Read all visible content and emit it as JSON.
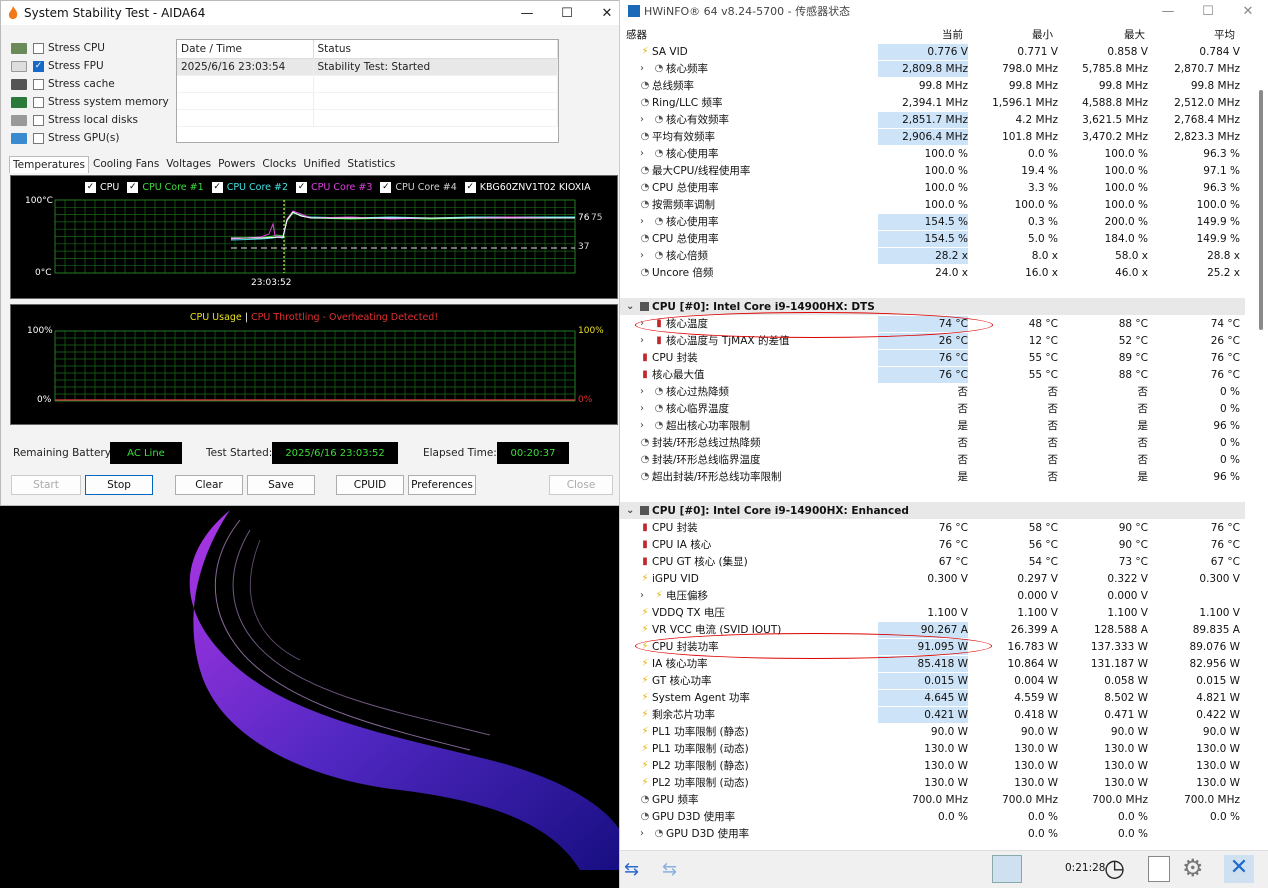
{
  "aida": {
    "title": "System Stability Test - AIDA64",
    "stress": [
      {
        "label": "Stress CPU",
        "checked": false
      },
      {
        "label": "Stress FPU",
        "checked": true
      },
      {
        "label": "Stress cache",
        "checked": false
      },
      {
        "label": "Stress system memory",
        "checked": false
      },
      {
        "label": "Stress local disks",
        "checked": false
      },
      {
        "label": "Stress GPU(s)",
        "checked": false
      }
    ],
    "log_headers": [
      "Date / Time",
      "Status"
    ],
    "log_rows": [
      [
        "2025/6/16 23:03:54",
        "Stability Test: Started"
      ]
    ],
    "tabs": [
      "Temperatures",
      "Cooling Fans",
      "Voltages",
      "Powers",
      "Clocks",
      "Unified",
      "Statistics"
    ],
    "temp_legend": [
      {
        "label": "CPU",
        "color": "#ffffff"
      },
      {
        "label": "CPU Core #1",
        "color": "#3cdc3c"
      },
      {
        "label": "CPU Core #2",
        "color": "#40e0e0"
      },
      {
        "label": "CPU Core #3",
        "color": "#e040e0"
      },
      {
        "label": "CPU Core #4",
        "color": "#d0d0d0"
      },
      {
        "label": "KBG60ZNV1T02 KIOXIA",
        "color": "#ffffff"
      }
    ],
    "temp_ymax": "100°C",
    "temp_ymin": "0°C",
    "temp_time": "23:03:52",
    "temp_right1": "76",
    "temp_right2": "75",
    "temp_right3": "37",
    "usage_title1": "CPU Usage",
    "usage_sep": "|",
    "usage_title2": "CPU Throttling - Overheating Detected!",
    "usage_left_top": "100%",
    "usage_left_bot": "0%",
    "usage_right_top": "100%",
    "usage_right_bot": "0%",
    "battery_label": "Remaining Battery:",
    "battery_value": "AC Line",
    "started_label": "Test Started:",
    "started_value": "2025/6/16 23:03:52",
    "elapsed_label": "Elapsed Time:",
    "elapsed_value": "00:20:37",
    "buttons": {
      "start": "Start",
      "stop": "Stop",
      "clear": "Clear",
      "save": "Save",
      "cpuid": "CPUID",
      "preferences": "Preferences",
      "close": "Close"
    }
  },
  "hw": {
    "title": "HWiNFO® 64 v8.24-5700 - 传感器状态",
    "headers": [
      "感器",
      "当前",
      "最小",
      "最大",
      "平均"
    ],
    "rows": [
      {
        "icon": "bolt",
        "label": "SA VID",
        "c": "0.776 V",
        "mn": "0.771 V",
        "mx": "0.858 V",
        "av": "0.784 V",
        "hl": true
      },
      {
        "icon": "clock",
        "exp": true,
        "label": "核心频率",
        "c": "2,809.8 MHz",
        "mn": "798.0 MHz",
        "mx": "5,785.8 MHz",
        "av": "2,870.7 MHz",
        "hl": true
      },
      {
        "icon": "clock",
        "label": "总线频率",
        "c": "99.8 MHz",
        "mn": "99.8 MHz",
        "mx": "99.8 MHz",
        "av": "99.8 MHz"
      },
      {
        "icon": "clock",
        "label": "Ring/LLC 频率",
        "c": "2,394.1 MHz",
        "mn": "1,596.1 MHz",
        "mx": "4,588.8 MHz",
        "av": "2,512.0 MHz"
      },
      {
        "icon": "clock",
        "exp": true,
        "label": "核心有效频率",
        "c": "2,851.7 MHz",
        "mn": "4.2 MHz",
        "mx": "3,621.5 MHz",
        "av": "2,768.4 MHz",
        "hl": true
      },
      {
        "icon": "clock",
        "label": "平均有效频率",
        "c": "2,906.4 MHz",
        "mn": "101.8 MHz",
        "mx": "3,470.2 MHz",
        "av": "2,823.3 MHz",
        "hl": true
      },
      {
        "icon": "clock",
        "exp": true,
        "label": "核心使用率",
        "c": "100.0 %",
        "mn": "0.0 %",
        "mx": "100.0 %",
        "av": "96.3 %"
      },
      {
        "icon": "clock",
        "label": "最大CPU/线程使用率",
        "c": "100.0 %",
        "mn": "19.4 %",
        "mx": "100.0 %",
        "av": "97.1 %"
      },
      {
        "icon": "clock",
        "label": "CPU 总使用率",
        "c": "100.0 %",
        "mn": "3.3 %",
        "mx": "100.0 %",
        "av": "96.3 %"
      },
      {
        "icon": "clock",
        "label": "按需频率调制",
        "c": "100.0 %",
        "mn": "100.0 %",
        "mx": "100.0 %",
        "av": "100.0 %"
      },
      {
        "icon": "clock",
        "exp": true,
        "label": "核心使用率",
        "c": "154.5 %",
        "mn": "0.3 %",
        "mx": "200.0 %",
        "av": "149.9 %",
        "hl": true
      },
      {
        "icon": "clock",
        "label": "CPU 总使用率",
        "c": "154.5 %",
        "mn": "5.0 %",
        "mx": "184.0 %",
        "av": "149.9 %",
        "hl": true
      },
      {
        "icon": "clock",
        "exp": true,
        "label": "核心倍频",
        "c": "28.2 x",
        "mn": "8.0 x",
        "mx": "58.0 x",
        "av": "28.8 x",
        "hl": true
      },
      {
        "icon": "clock",
        "label": "Uncore 倍频",
        "c": "24.0 x",
        "mn": "16.0 x",
        "mx": "46.0 x",
        "av": "25.2 x"
      },
      {
        "blank": true
      },
      {
        "section": true,
        "label": "CPU [#0]: Intel Core i9-14900HX: DTS"
      },
      {
        "icon": "therm",
        "exp": true,
        "label": "核心温度",
        "c": "74 °C",
        "mn": "48 °C",
        "mx": "88 °C",
        "av": "74 °C",
        "hl": true
      },
      {
        "icon": "therm",
        "exp": true,
        "label": "核心温度与 TjMAX 的差值",
        "c": "26 °C",
        "mn": "12 °C",
        "mx": "52 °C",
        "av": "26 °C",
        "hl": true
      },
      {
        "icon": "therm",
        "label": "CPU 封装",
        "c": "76 °C",
        "mn": "55 °C",
        "mx": "89 °C",
        "av": "76 °C",
        "hl": true
      },
      {
        "icon": "therm",
        "label": "核心最大值",
        "c": "76 °C",
        "mn": "55 °C",
        "mx": "88 °C",
        "av": "76 °C",
        "hl": true
      },
      {
        "icon": "clock",
        "exp": true,
        "label": "核心过热降频",
        "c": "否",
        "mn": "否",
        "mx": "否",
        "av": "0 %"
      },
      {
        "icon": "clock",
        "exp": true,
        "label": "核心临界温度",
        "c": "否",
        "mn": "否",
        "mx": "否",
        "av": "0 %"
      },
      {
        "icon": "clock",
        "exp": true,
        "label": "超出核心功率限制",
        "c": "是",
        "mn": "否",
        "mx": "是",
        "av": "96 %"
      },
      {
        "icon": "clock",
        "label": "封装/环形总线过热降频",
        "c": "否",
        "mn": "否",
        "mx": "否",
        "av": "0 %"
      },
      {
        "icon": "clock",
        "label": "封装/环形总线临界温度",
        "c": "否",
        "mn": "否",
        "mx": "否",
        "av": "0 %"
      },
      {
        "icon": "clock",
        "label": "超出封装/环形总线功率限制",
        "c": "是",
        "mn": "否",
        "mx": "是",
        "av": "96 %"
      },
      {
        "blank": true
      },
      {
        "section": true,
        "label": "CPU [#0]: Intel Core i9-14900HX: Enhanced"
      },
      {
        "icon": "therm",
        "label": "CPU 封装",
        "c": "76 °C",
        "mn": "58 °C",
        "mx": "90 °C",
        "av": "76 °C"
      },
      {
        "icon": "therm",
        "label": "CPU IA 核心",
        "c": "76 °C",
        "mn": "56 °C",
        "mx": "90 °C",
        "av": "76 °C"
      },
      {
        "icon": "therm",
        "label": "CPU GT 核心 (集显)",
        "c": "67 °C",
        "mn": "54 °C",
        "mx": "73 °C",
        "av": "67 °C"
      },
      {
        "icon": "bolt",
        "label": "iGPU VID",
        "c": "0.300 V",
        "mn": "0.297 V",
        "mx": "0.322 V",
        "av": "0.300 V"
      },
      {
        "icon": "bolt",
        "exp": true,
        "label": "电压偏移",
        "c": "",
        "mn": "0.000 V",
        "mx": "0.000 V",
        "av": ""
      },
      {
        "icon": "bolt",
        "label": "VDDQ TX 电压",
        "c": "1.100 V",
        "mn": "1.100 V",
        "mx": "1.100 V",
        "av": "1.100 V"
      },
      {
        "icon": "bolt",
        "label": "VR VCC 电流 (SVID IOUT)",
        "c": "90.267 A",
        "mn": "26.399 A",
        "mx": "128.588 A",
        "av": "89.835 A",
        "hl": true
      },
      {
        "icon": "bolt",
        "label": "CPU 封装功率",
        "c": "91.095 W",
        "mn": "16.783 W",
        "mx": "137.333 W",
        "av": "89.076 W",
        "hl": true
      },
      {
        "icon": "bolt",
        "label": "IA 核心功率",
        "c": "85.418 W",
        "mn": "10.864 W",
        "mx": "131.187 W",
        "av": "82.956 W",
        "hl": true
      },
      {
        "icon": "bolt",
        "label": "GT 核心功率",
        "c": "0.015 W",
        "mn": "0.004 W",
        "mx": "0.058 W",
        "av": "0.015 W",
        "hl": true
      },
      {
        "icon": "bolt",
        "label": "System Agent 功率",
        "c": "4.645 W",
        "mn": "4.559 W",
        "mx": "8.502 W",
        "av": "4.821 W",
        "hl": true
      },
      {
        "icon": "bolt",
        "label": "剩余芯片功率",
        "c": "0.421 W",
        "mn": "0.418 W",
        "mx": "0.471 W",
        "av": "0.422 W",
        "hl": true
      },
      {
        "icon": "bolt",
        "label": "PL1 功率限制 (静态)",
        "c": "90.0 W",
        "mn": "90.0 W",
        "mx": "90.0 W",
        "av": "90.0 W"
      },
      {
        "icon": "bolt",
        "label": "PL1 功率限制 (动态)",
        "c": "130.0 W",
        "mn": "130.0 W",
        "mx": "130.0 W",
        "av": "130.0 W"
      },
      {
        "icon": "bolt",
        "label": "PL2 功率限制 (静态)",
        "c": "130.0 W",
        "mn": "130.0 W",
        "mx": "130.0 W",
        "av": "130.0 W"
      },
      {
        "icon": "bolt",
        "label": "PL2 功率限制 (动态)",
        "c": "130.0 W",
        "mn": "130.0 W",
        "mx": "130.0 W",
        "av": "130.0 W"
      },
      {
        "icon": "clock",
        "label": "GPU 频率",
        "c": "700.0 MHz",
        "mn": "700.0 MHz",
        "mx": "700.0 MHz",
        "av": "700.0 MHz"
      },
      {
        "icon": "clock",
        "label": "GPU D3D 使用率",
        "c": "0.0 %",
        "mn": "0.0 %",
        "mx": "0.0 %",
        "av": "0.0 %"
      },
      {
        "icon": "clock",
        "exp": true,
        "label": "GPU D3D 使用率",
        "c": "",
        "mn": "0.0 %",
        "mx": "0.0 %",
        "av": ""
      }
    ],
    "status_time": "0:21:28"
  }
}
